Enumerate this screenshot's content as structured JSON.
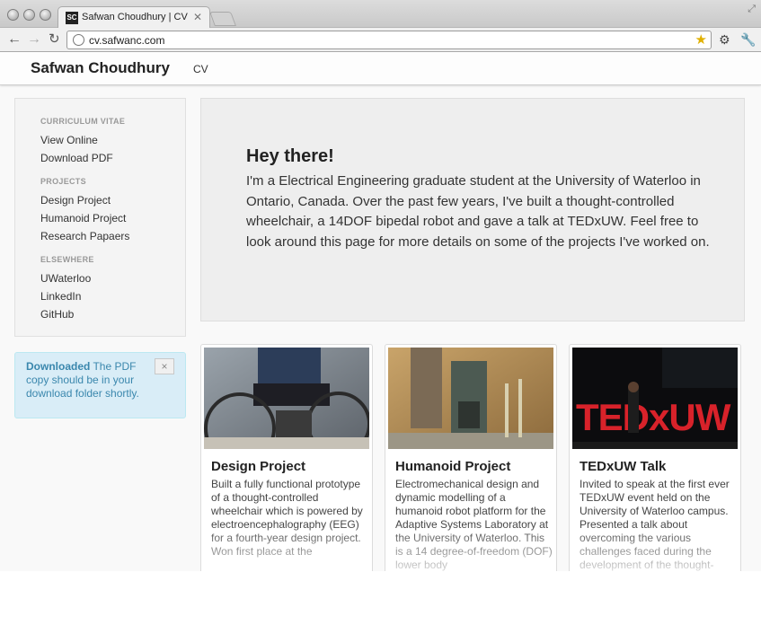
{
  "browser": {
    "tab_title": "Safwan Choudhury | CV",
    "tab_favicon": "SC",
    "url": "cv.safwanc.com"
  },
  "topnav": {
    "brand": "Safwan Choudhury",
    "link": "CV"
  },
  "sidebar": {
    "sections": [
      {
        "header": "CURRICULUM VITAE",
        "items": [
          "View Online",
          "Download PDF"
        ]
      },
      {
        "header": "PROJECTS",
        "items": [
          "Design Project",
          "Humanoid Project",
          "Research Papaers"
        ]
      },
      {
        "header": "ELSEWHERE",
        "items": [
          "UWaterloo",
          "LinkedIn",
          "GitHub"
        ]
      }
    ]
  },
  "alert": {
    "strong": "Downloaded",
    "text": " The PDF copy should be in your download folder shortly.",
    "close": "×"
  },
  "hero": {
    "title": "Hey there!",
    "body": "I'm a Electrical Engineering graduate student at the University of Waterloo in Ontario, Canada. Over the past few years, I've built a thought-controlled wheelchair, a 14DOF bipedal robot and gave a talk at TEDxUW. Feel free to look around this page for more details on some of the projects I've worked on."
  },
  "cards": [
    {
      "title": "Design Project",
      "description": "Built a fully functional prototype of a thought-controlled wheelchair which is powered by electroencephalography (EEG) for a fourth-year design project. Won first place at the",
      "image": "wheelchair-photo"
    },
    {
      "title": "Humanoid Project",
      "description": "Electromechanical design and dynamic modelling of a humanoid robot platform for the Adaptive Systems Laboratory at the University of Waterloo. This is a 14 degree-of-freedom (DOF) lower body",
      "image": "robot-photo"
    },
    {
      "title": "TEDxUW Talk",
      "description": "Invited to speak at the first ever TEDxUW event held on the University of Waterloo campus. Presented a talk about overcoming the various challenges faced during the development of the thought-",
      "image": "tedx-photo",
      "image_text": "TEDxUW"
    }
  ]
}
